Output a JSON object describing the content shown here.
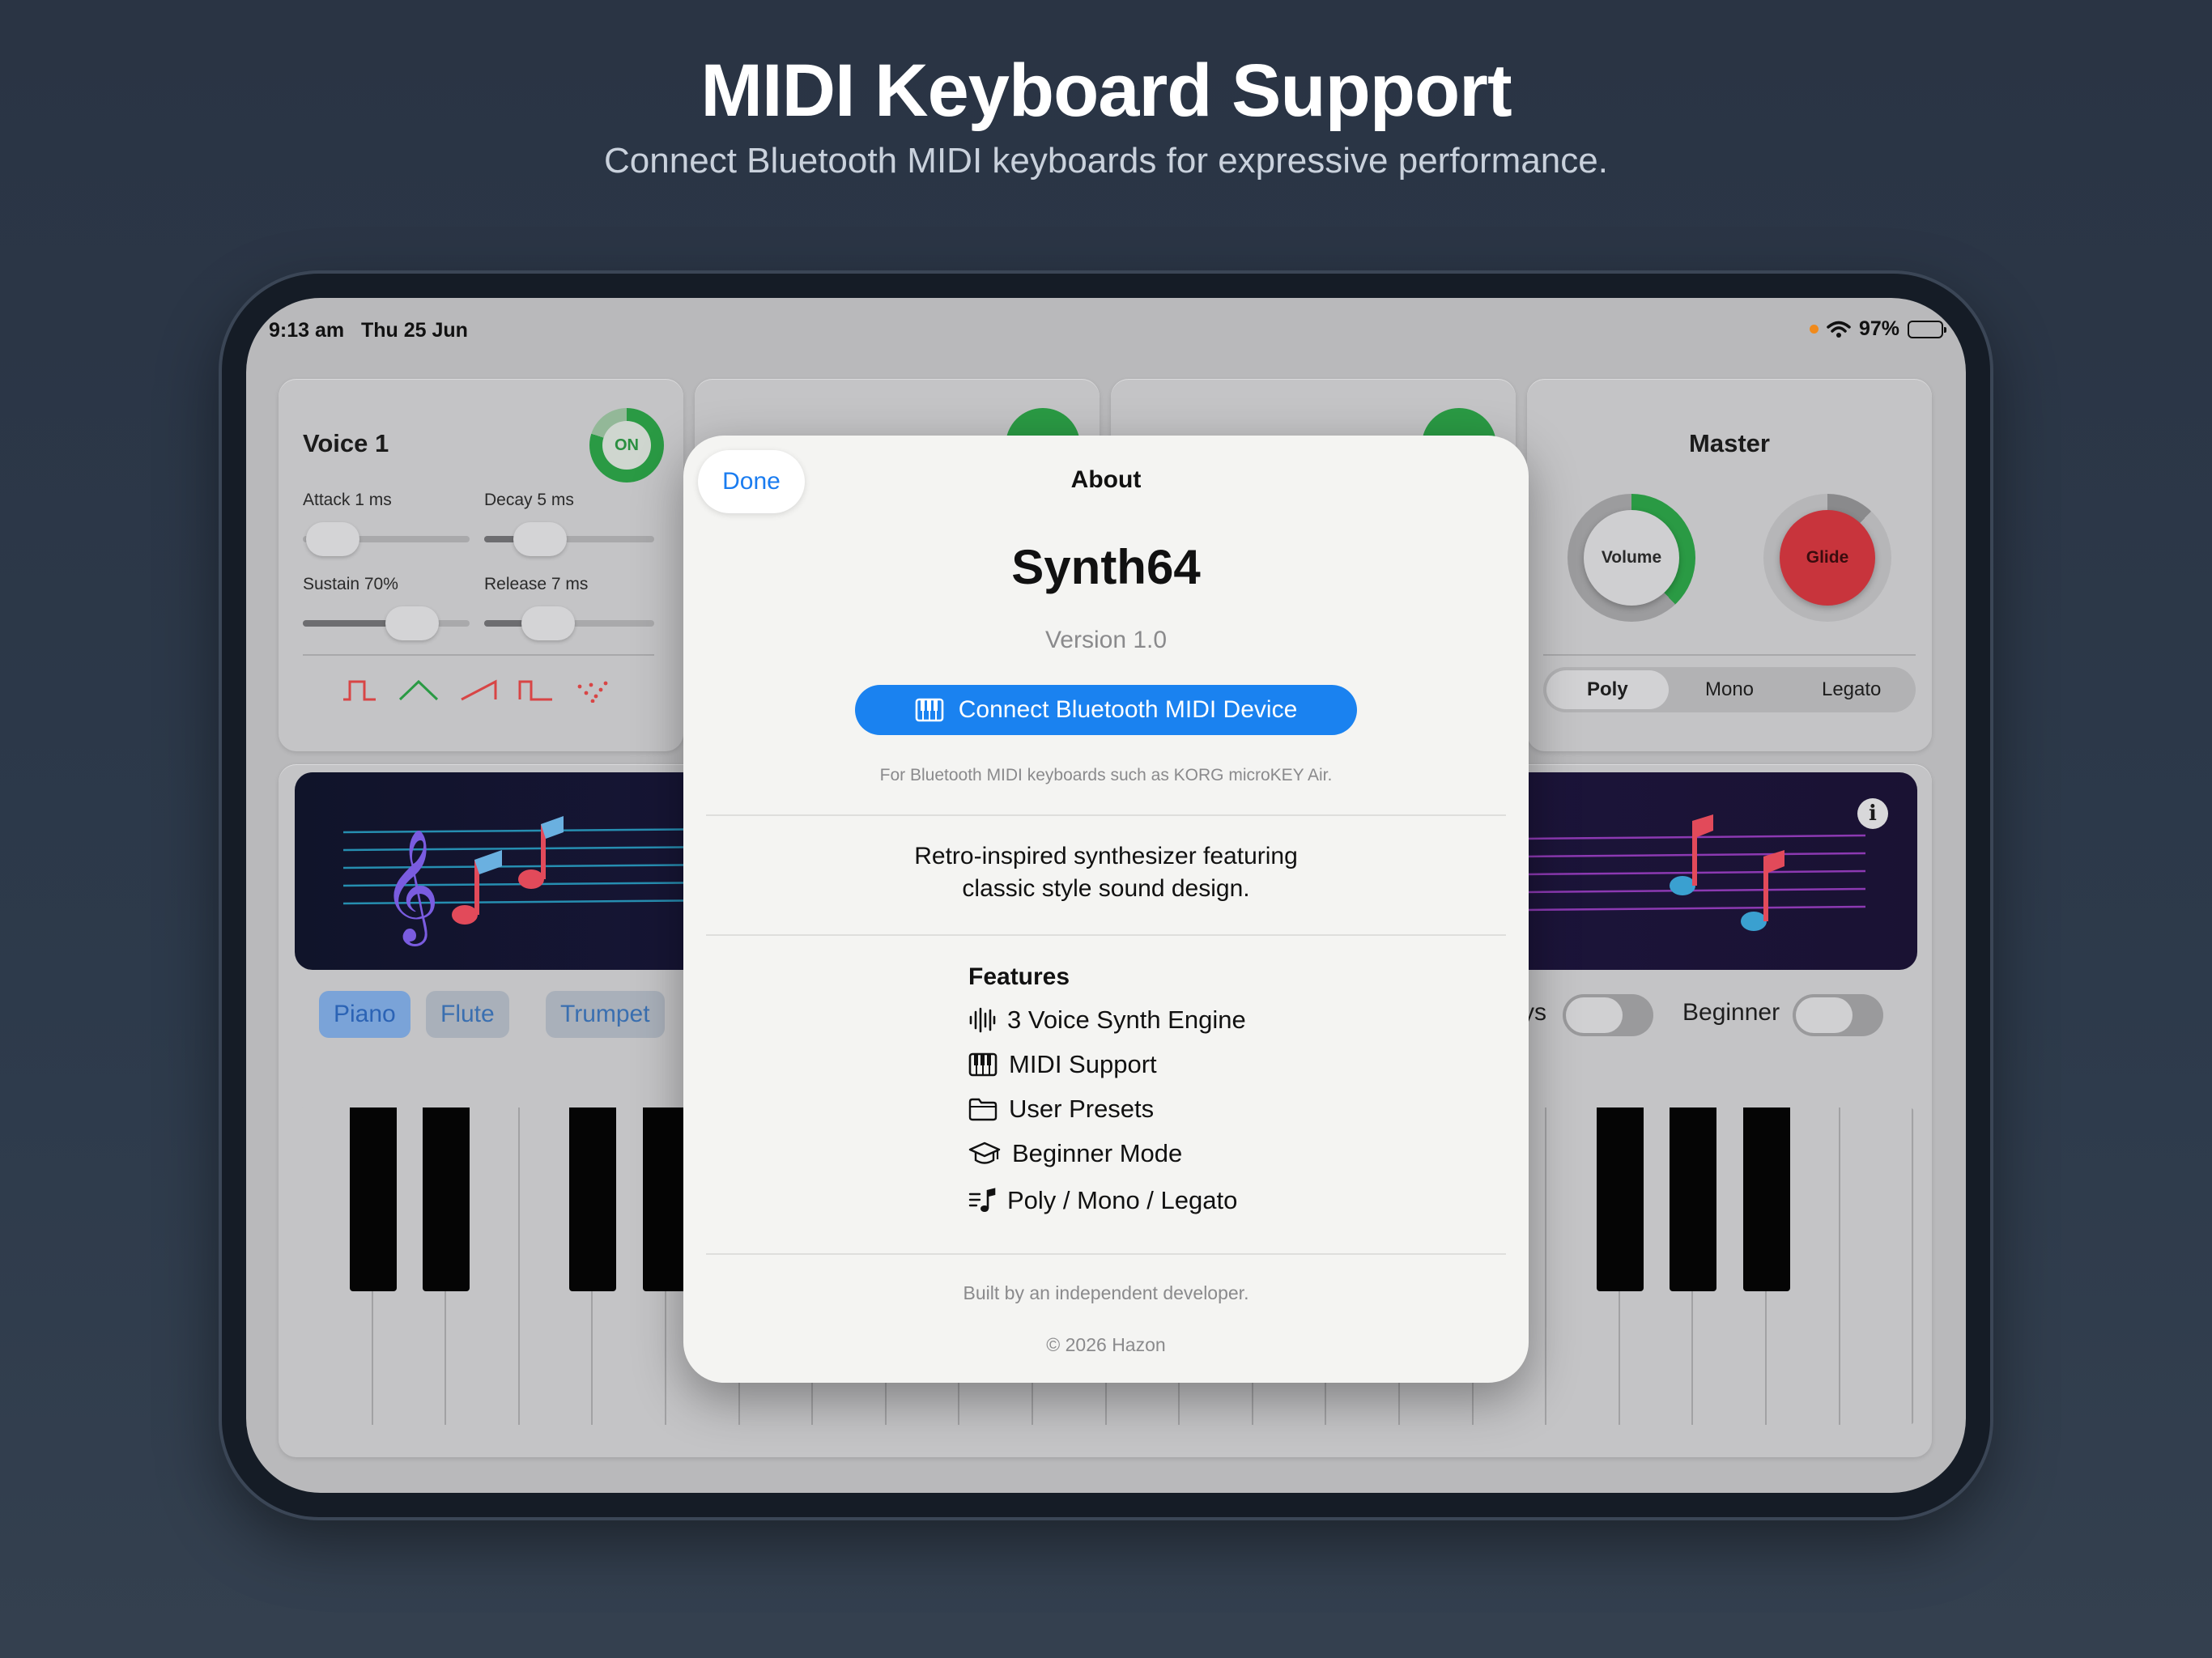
{
  "marketing": {
    "headline": "MIDI Keyboard Support",
    "subheadline": "Connect Bluetooth MIDI keyboards for expressive performance."
  },
  "status_bar": {
    "time": "9:13 am",
    "date": "Thu 25 Jun",
    "battery": "97%",
    "icons": [
      "privacy-dot",
      "wifi-icon",
      "battery-icon"
    ]
  },
  "voice_panel": {
    "title": "Voice 1",
    "toggle_label": "ON",
    "attack_label": "Attack 1 ms",
    "decay_label": "Decay 5 ms",
    "sustain_label": "Sustain 70%",
    "release_label": "Release 7 ms",
    "sustain_level": 0.7,
    "waveforms": [
      "square-wave-icon",
      "triangle-wave-icon",
      "sawtooth-wave-icon",
      "pulse-wave-icon",
      "noise-wave-icon"
    ]
  },
  "master_panel": {
    "title": "Master",
    "volume_label": "Volume",
    "glide_label": "Glide",
    "modes": [
      "Poly",
      "Mono",
      "Legato"
    ],
    "active_mode": "Poly"
  },
  "instruments": [
    "Piano",
    "Flute",
    "Trumpet"
  ],
  "active_instrument": "Piano",
  "toggles": {
    "keys_label_fragment": "ys",
    "beginner_label": "Beginner"
  },
  "about": {
    "done_label": "Done",
    "title": "About",
    "app_name": "Synth64",
    "version": "Version 1.0",
    "connect_button": "Connect Bluetooth MIDI Device",
    "connect_hint": "For Bluetooth MIDI keyboards such as KORG microKEY Air.",
    "description_line1": "Retro-inspired synthesizer featuring",
    "description_line2": "classic style sound design.",
    "features_title": "Features",
    "features": [
      {
        "label": "3 Voice Synth Engine",
        "icon": "waveform-icon"
      },
      {
        "label": "MIDI Support",
        "icon": "piano-keys-icon"
      },
      {
        "label": "User Presets",
        "icon": "folder-icon"
      },
      {
        "label": "Beginner Mode",
        "icon": "graduation-cap-icon"
      },
      {
        "label": "Poly / Mono / Legato",
        "icon": "music-list-icon"
      }
    ],
    "footer_line1": "Built by an independent developer.",
    "footer_line2": "© 2026 Hazon"
  },
  "colors": {
    "accent_blue": "#1a82f0",
    "on_green": "#2a9a44",
    "glide_red": "#c8343c",
    "waveform_red": "#d84545",
    "waveform_green": "#2a9a44"
  }
}
